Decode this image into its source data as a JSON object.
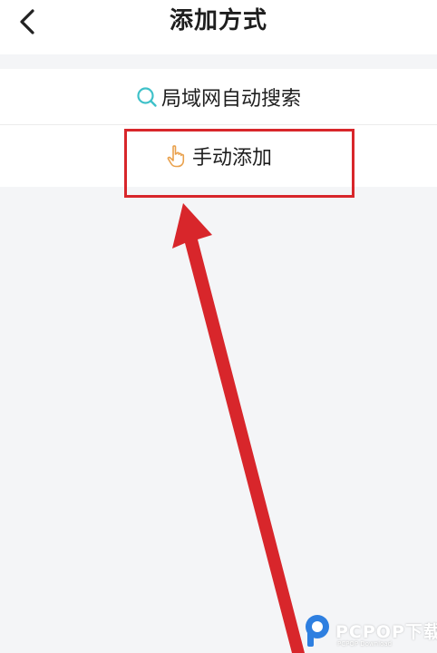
{
  "header": {
    "title": "添加方式",
    "back_icon": "chevron-left-icon"
  },
  "options": [
    {
      "label": "局域网自动搜索",
      "icon": "search-icon"
    },
    {
      "label": "手动添加",
      "icon": "pointing-hand-icon"
    }
  ],
  "annotation": {
    "color": "#d8262b"
  },
  "watermark": {
    "brand": "PCPOP下载",
    "tagline": "PCPOP Download"
  },
  "colors": {
    "accent_teal": "#3fc1c9",
    "hand_orange": "#e9a14d"
  }
}
